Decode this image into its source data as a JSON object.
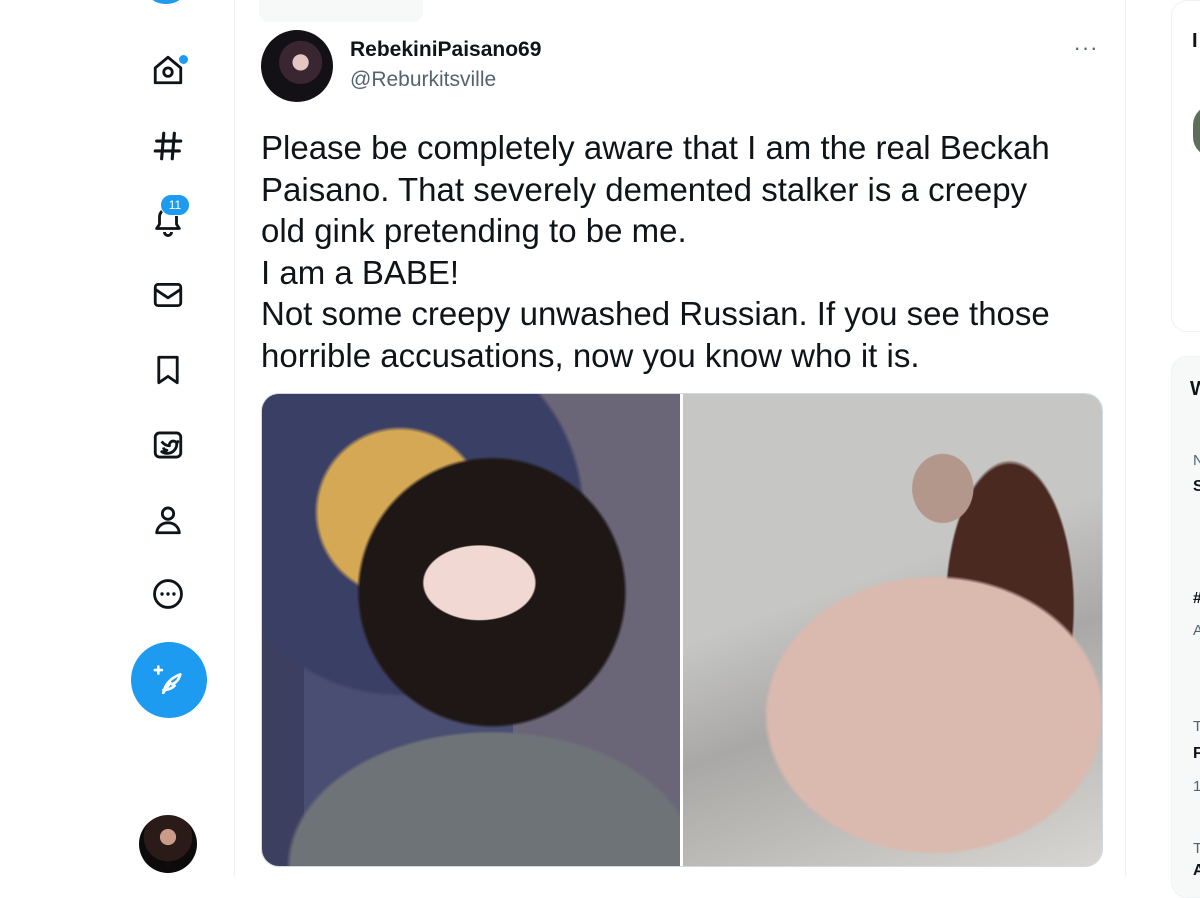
{
  "nav": {
    "items": [
      {
        "name": "home",
        "icon": "home-icon",
        "has_dot": true
      },
      {
        "name": "explore",
        "icon": "hashtag-icon"
      },
      {
        "name": "notifications",
        "icon": "bell-icon",
        "badge": "11"
      },
      {
        "name": "messages",
        "icon": "envelope-icon"
      },
      {
        "name": "bookmarks",
        "icon": "bookmark-icon"
      },
      {
        "name": "twitter-blue",
        "icon": "twitter-blue-icon"
      },
      {
        "name": "profile",
        "icon": "person-icon"
      },
      {
        "name": "more",
        "icon": "more-circle-icon"
      }
    ],
    "tweet_button_icon": "feather-plus-icon",
    "accent": "#1d9bf0"
  },
  "tweet": {
    "display_name": "RebekiniPaisano69",
    "handle": "@Reburkitsville",
    "more_label": "···",
    "text_lines": [
      "Please be completely aware that I am the real Beckah",
      "Paisano. That severely demented stalker is a creepy",
      "old gink pretending to be me.",
      "I am a BABE!",
      "Not some creepy unwashed Russian. If you see those",
      "horrible accusations, now you know who it is."
    ],
    "media_count": 2
  },
  "sidebar_peek": {
    "card1_letter": "I",
    "card2_lines": [
      "W",
      "N",
      "S",
      "#",
      "A",
      "T",
      "F",
      "1",
      "T",
      "A"
    ]
  }
}
